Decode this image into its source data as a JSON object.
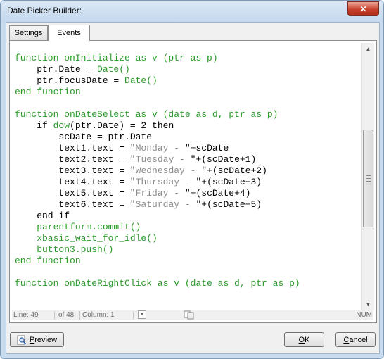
{
  "window": {
    "title": "Date Picker Builder:",
    "close_glyph": "✕"
  },
  "tabs": [
    {
      "label": "Settings"
    },
    {
      "label": "Events"
    }
  ],
  "code_lines": [
    [
      [
        "g",
        "function onInitialize as v (ptr as p)"
      ]
    ],
    [
      [
        "k",
        "    ptr.Date = "
      ],
      [
        "g",
        "Date()"
      ]
    ],
    [
      [
        "k",
        "    ptr.focusDate = "
      ],
      [
        "g",
        "Date()"
      ]
    ],
    [
      [
        "g",
        "end function"
      ]
    ],
    [
      [
        "k",
        ""
      ]
    ],
    [
      [
        "g",
        "function onDateSelect as v (date as d, ptr as p)"
      ]
    ],
    [
      [
        "k",
        "    if "
      ],
      [
        "g",
        "dow"
      ],
      [
        "k",
        "(ptr.Date) = 2 then"
      ]
    ],
    [
      [
        "k",
        "        scDate = ptr.Date"
      ]
    ],
    [
      [
        "k",
        "        text1.text = \""
      ],
      [
        "s",
        "Monday - "
      ],
      [
        "k",
        "\"+scDate"
      ]
    ],
    [
      [
        "k",
        "        text2.text = \""
      ],
      [
        "s",
        "Tuesday - "
      ],
      [
        "k",
        "\"+(scDate+1)"
      ]
    ],
    [
      [
        "k",
        "        text3.text = \""
      ],
      [
        "s",
        "Wednesday - "
      ],
      [
        "k",
        "\"+(scDate+2)"
      ]
    ],
    [
      [
        "k",
        "        text4.text = \""
      ],
      [
        "s",
        "Thursday - "
      ],
      [
        "k",
        "\"+(scDate+3)"
      ]
    ],
    [
      [
        "k",
        "        text5.text = \""
      ],
      [
        "s",
        "Friday - "
      ],
      [
        "k",
        "\"+(scDate+4)"
      ]
    ],
    [
      [
        "k",
        "        text6.text = \""
      ],
      [
        "s",
        "Saturday - "
      ],
      [
        "k",
        "\"+(scDate+5)"
      ]
    ],
    [
      [
        "k",
        "    end if"
      ]
    ],
    [
      [
        "g",
        "    parentform.commit()"
      ]
    ],
    [
      [
        "g",
        "    xbasic_wait_for_idle()"
      ]
    ],
    [
      [
        "g",
        "    button3.push()"
      ]
    ],
    [
      [
        "g",
        "end function"
      ]
    ],
    [
      [
        "k",
        ""
      ]
    ],
    [
      [
        "g",
        "function onDateRightClick as v (date as d, ptr as p)"
      ]
    ]
  ],
  "status": {
    "line_label": "Line: 49",
    "of_label": "of 48",
    "column_label": "Column: 1",
    "num_label": "NUM"
  },
  "buttons": {
    "preview": "Preview",
    "ok": "OK",
    "cancel": "Cancel"
  },
  "colors": {
    "keyword_green": "#2a9a2a",
    "string_gray": "#8c8c8c",
    "title_bg": "#c9dcef"
  }
}
